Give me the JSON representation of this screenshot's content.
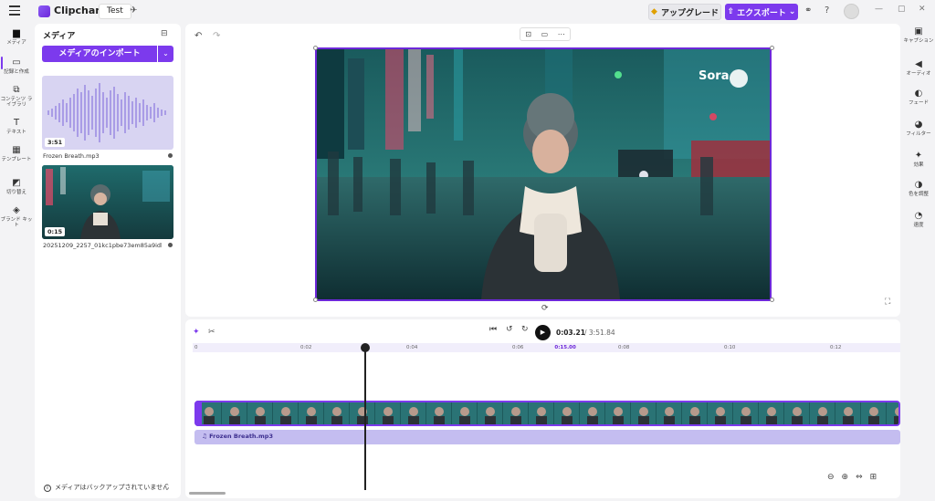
{
  "topbar": {
    "app_name": "Clipchamp",
    "project_name": "Test",
    "upgrade_label": "アップグレード",
    "export_label": "エクスポート",
    "export_chevron": "⌄",
    "help": "?"
  },
  "left_rail": [
    {
      "label": "メディア",
      "icon": "folder-icon",
      "glyph": "▆"
    },
    {
      "label": "記録と作成",
      "icon": "camera-icon",
      "glyph": "▭"
    },
    {
      "label": "コンテンツ ライブラリ",
      "icon": "library-icon",
      "glyph": "⧉"
    },
    {
      "label": "テキスト",
      "icon": "text-icon",
      "glyph": "T"
    },
    {
      "label": "テンプレート",
      "icon": "template-icon",
      "glyph": "▦"
    },
    {
      "label": "切り替え",
      "icon": "transition-icon",
      "glyph": "◩"
    },
    {
      "label": "ブランド キット",
      "icon": "brand-kit-icon",
      "glyph": "◈"
    }
  ],
  "media_panel": {
    "title": "メディア",
    "import_label": "メディアのインポート",
    "items": [
      {
        "duration": "3:51",
        "name": "Frozen Breath.mp3"
      },
      {
        "duration": "0:15",
        "name": "20251209_2257_01kc1pbe73em85a9idha851..."
      }
    ],
    "backup_note": "メディアはバックアップされていません"
  },
  "preview": {
    "watermark": "Sora"
  },
  "timeline": {
    "current_time": "0:03.21",
    "total_time": "/ 3:51.84",
    "ruler_ticks": [
      {
        "label": "0",
        "pos": 0
      },
      {
        "label": "0:02",
        "pos": 1
      },
      {
        "label": "0:04",
        "pos": 2
      },
      {
        "label": "0:06",
        "pos": 3
      },
      {
        "label": "0:15.00",
        "pos": 3.4,
        "highlight": true
      },
      {
        "label": "0:08",
        "pos": 4
      },
      {
        "label": "0:10",
        "pos": 5
      },
      {
        "label": "0:12",
        "pos": 6
      }
    ],
    "audio_track_label": "Frozen Breath.mp3"
  },
  "right_rail": [
    {
      "label": "キャプション",
      "icon": "captions-icon",
      "glyph": "▣"
    },
    {
      "label": "オーディオ",
      "icon": "audio-icon",
      "glyph": "◀"
    },
    {
      "label": "フェード",
      "icon": "fade-icon",
      "glyph": "◐"
    },
    {
      "label": "フィルター",
      "icon": "filter-icon",
      "glyph": "◕"
    },
    {
      "label": "効果",
      "icon": "effects-icon",
      "glyph": "✦"
    },
    {
      "label": "色を調整",
      "icon": "color-adjust-icon",
      "glyph": "◑"
    },
    {
      "label": "速度",
      "icon": "speed-icon",
      "glyph": "◔"
    }
  ],
  "colors": {
    "accent": "#7c3aed",
    "video_track": "#1d5a5c",
    "audio_track": "#c4bdf0"
  }
}
